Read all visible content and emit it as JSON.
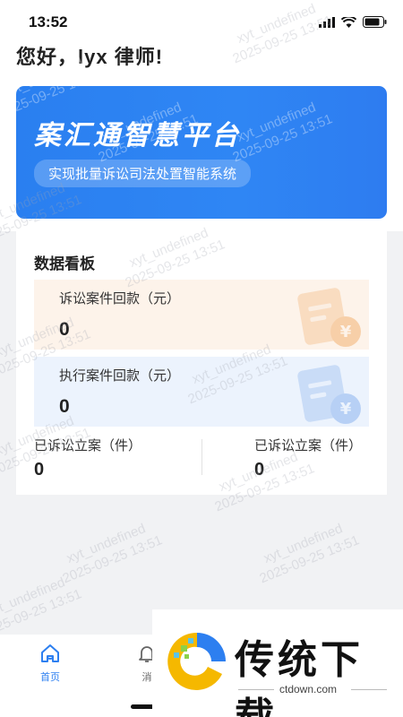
{
  "status_bar": {
    "time": "13:52"
  },
  "greeting": "您好，lyx 律师!",
  "banner": {
    "title": "案汇通智慧平台",
    "subtitle": "实现批量诉讼司法处置智能系统"
  },
  "board": {
    "title": "数据看板",
    "litigation_payment": {
      "label": "诉讼案件回款（元）",
      "value": "0"
    },
    "execution_payment": {
      "label": "执行案件回款（元）",
      "value": "0"
    },
    "filed_left": {
      "label": "已诉讼立案（件）",
      "value": "0"
    },
    "filed_right": {
      "label": "已诉讼立案（件）",
      "value": "0"
    }
  },
  "tabbar": {
    "home": {
      "label": "首页",
      "icon": "home-icon"
    },
    "messages": {
      "label": "消",
      "icon": "bell-icon"
    }
  },
  "watermark": {
    "user": "xyt_undefined",
    "time": "2025-09-25 13:51"
  },
  "ad": {
    "text": "传统下载",
    "url": "ctdown.com"
  },
  "colors": {
    "accent": "#2d7ff0",
    "banner": "#2f86f4",
    "orange_card": "#fdf3ea",
    "blue_card": "#ecf3fd"
  }
}
